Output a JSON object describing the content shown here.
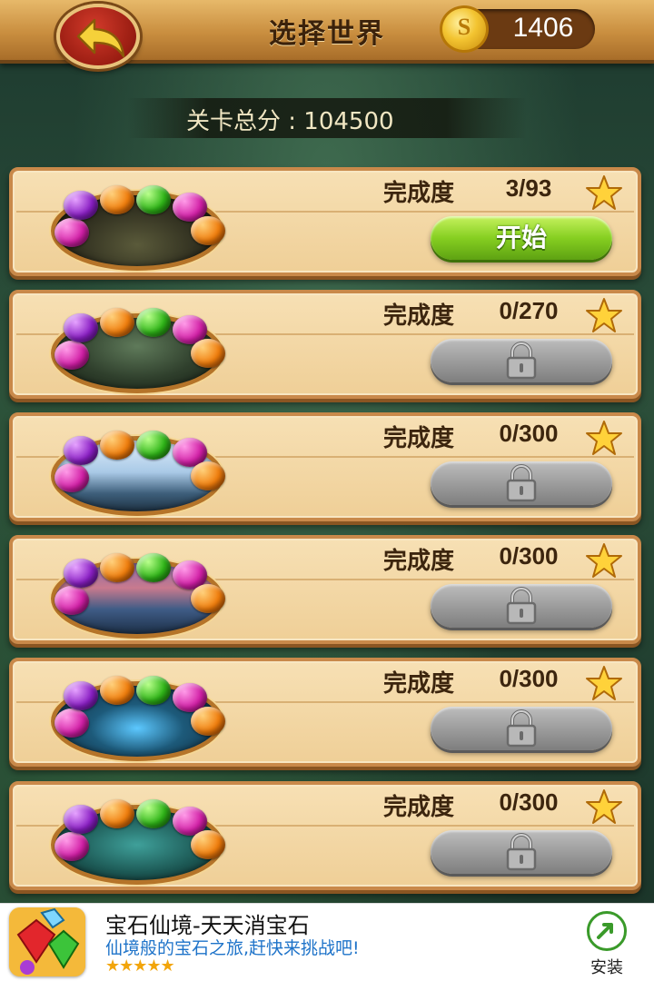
{
  "header": {
    "title": "选择世界",
    "coins": "1406",
    "coin_symbol": "S"
  },
  "total_score": {
    "label": "关卡总分 : 104500"
  },
  "worlds": [
    {
      "progress_label": "完成度",
      "progress": "3/93",
      "unlocked": true,
      "action_label": "开始",
      "scene": "dark-forest"
    },
    {
      "progress_label": "完成度",
      "progress": "0/270",
      "unlocked": false,
      "scene": "mountain-peak"
    },
    {
      "progress_label": "完成度",
      "progress": "0/300",
      "unlocked": false,
      "scene": "snowy-mountains"
    },
    {
      "progress_label": "完成度",
      "progress": "0/300",
      "unlocked": false,
      "scene": "stormy-coast"
    },
    {
      "progress_label": "完成度",
      "progress": "0/300",
      "unlocked": false,
      "scene": "glowing-forest"
    },
    {
      "progress_label": "完成度",
      "progress": "0/300",
      "unlocked": false,
      "scene": "teal-jungle"
    }
  ],
  "ad": {
    "title": "宝石仙境-天天消宝石",
    "subtitle": "仙境般的宝石之旅,赶快来挑战吧!",
    "rating_stars": "★★★★★",
    "install_label": "安装"
  },
  "colors": {
    "gem_purple": "#8a1fc4",
    "gem_orange": "#f07d0c",
    "gem_green": "#2fb518",
    "gem_magenta": "#d21fa6",
    "start_green": "#86cf21",
    "locked_gray": "#9d9d9d"
  }
}
